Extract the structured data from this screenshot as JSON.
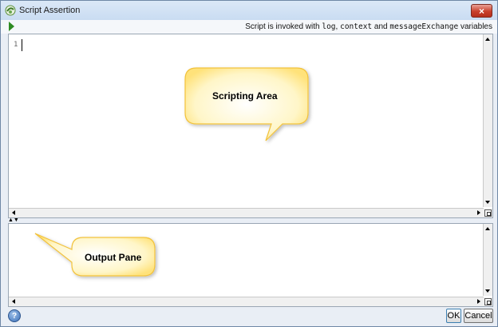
{
  "window": {
    "title": "Script Assertion",
    "close_label": "×"
  },
  "toolbar": {
    "hint_prefix": "Script is invoked with ",
    "var_log": "log",
    "sep1": ", ",
    "var_context": "context",
    "sep2": " and ",
    "var_messageExchange": "messageExchange",
    "hint_suffix": " variables"
  },
  "editor": {
    "line_number": "1"
  },
  "callouts": {
    "scripting_area": "Scripting Area",
    "output_pane": "Output Pane"
  },
  "footer": {
    "help_label": "?",
    "ok_label": "OK",
    "cancel_label": "Cancel"
  },
  "colors": {
    "callout_fill": "#fffbe0",
    "callout_stroke": "#f2c23a",
    "run_icon": "#2e8b22",
    "close_button": "#c9402c"
  },
  "icons": {
    "run": "play-triangle-icon",
    "help": "help-icon",
    "close": "close-icon"
  }
}
